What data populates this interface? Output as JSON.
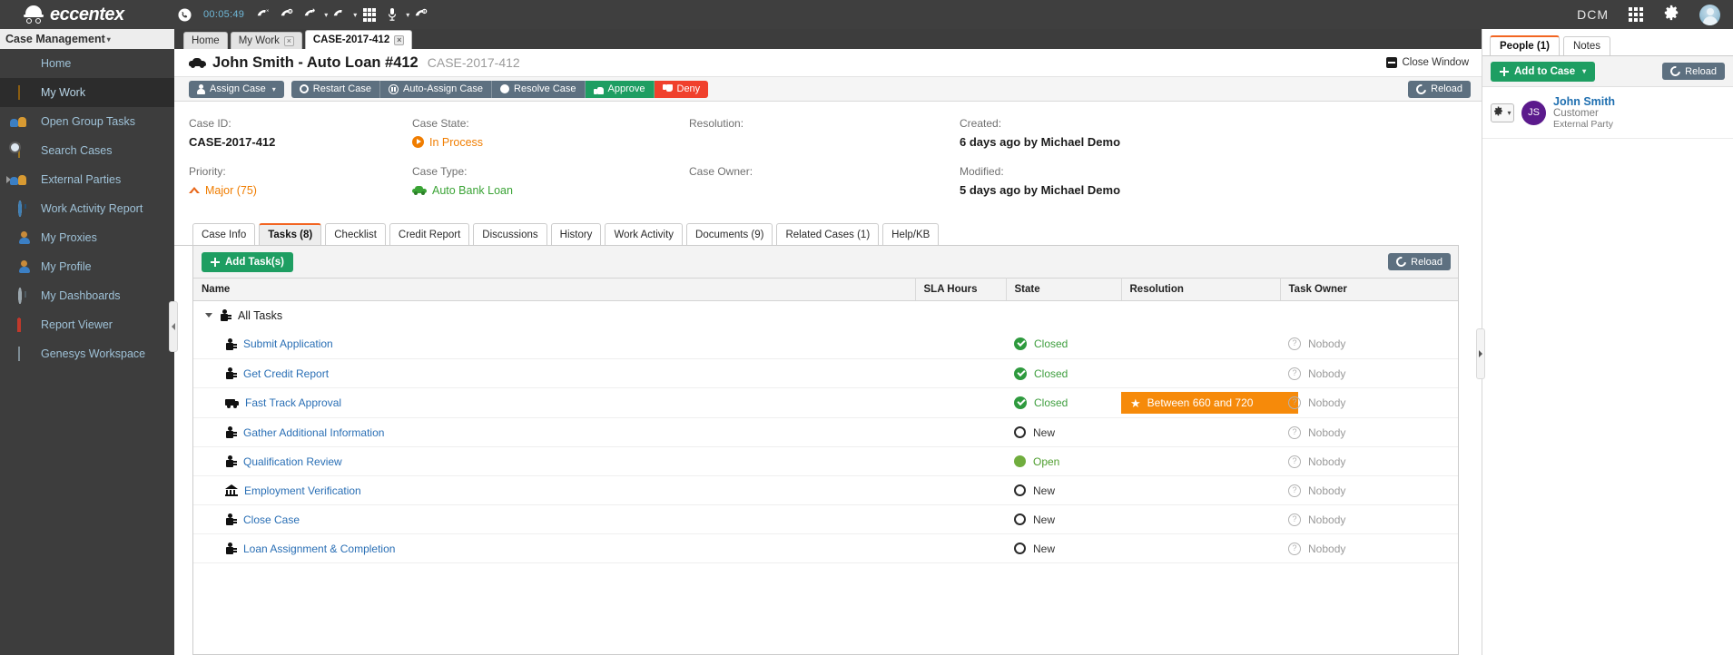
{
  "topbar": {
    "brand": "eccentex",
    "call_timer": "00:05:49",
    "phone_tools": [
      {
        "name": "call-active-icon",
        "glyph": "☎"
      },
      {
        "name": "call-reject-icon",
        "glyph": "☎"
      },
      {
        "name": "call-hold-icon",
        "glyph": "☎"
      },
      {
        "name": "call-transfer-icon",
        "glyph": "☎"
      },
      {
        "name": "call-consult-icon",
        "glyph": "☎"
      },
      {
        "name": "keypad-icon",
        "glyph": "keypad"
      },
      {
        "name": "microphone-icon",
        "glyph": "Ἲ4"
      },
      {
        "name": "call-pause-icon",
        "glyph": "☎"
      }
    ],
    "app_label": "DCM",
    "apps_icon": "grid-icon",
    "settings_icon": "gear-icon",
    "avatar_icon": "user-avatar-icon"
  },
  "sidebar": {
    "header": "Case Management",
    "items": [
      {
        "label": "Home",
        "icon": "pie-chart-icon",
        "active": false,
        "expandable": false
      },
      {
        "label": "My Work",
        "icon": "inbox-icon",
        "active": true,
        "expandable": false
      },
      {
        "label": "Open Group Tasks",
        "icon": "group-icon",
        "active": false,
        "expandable": false
      },
      {
        "label": "Search Cases",
        "icon": "folder-search-icon",
        "active": false,
        "expandable": false
      },
      {
        "label": "External Parties",
        "icon": "group-icon",
        "active": false,
        "expandable": true
      },
      {
        "label": "Work Activity Report",
        "icon": "clock-icon",
        "active": false,
        "expandable": false
      },
      {
        "label": "My Proxies",
        "icon": "person-icon",
        "active": false,
        "expandable": false
      },
      {
        "label": "My Profile",
        "icon": "person-icon",
        "active": false,
        "expandable": false
      },
      {
        "label": "My Dashboards",
        "icon": "dashboard-icon",
        "active": false,
        "expandable": false
      },
      {
        "label": "Report Viewer",
        "icon": "report-icon",
        "active": false,
        "expandable": false
      },
      {
        "label": "Genesys Workspace",
        "icon": "phone-device-icon",
        "active": false,
        "expandable": false
      }
    ]
  },
  "window_tabs": [
    {
      "label": "Home",
      "closable": false,
      "active": false
    },
    {
      "label": "My Work",
      "closable": true,
      "active": false
    },
    {
      "label": "CASE-2017-412",
      "closable": true,
      "active": true
    }
  ],
  "case_header": {
    "title": "John Smith - Auto Loan #412",
    "code": "CASE-2017-412",
    "close_window": "Close Window",
    "title_icon": "car-icon",
    "minimize_icon": "minimize-icon"
  },
  "action_bar": {
    "buttons": [
      {
        "label": "Assign Case",
        "style": "grey",
        "icon": "user-icon",
        "caret": true
      },
      {
        "label": "Restart Case",
        "style": "grey",
        "icon": "circle-outline-icon",
        "caret": false
      },
      {
        "label": "Auto-Assign Case",
        "style": "grey",
        "icon": "pause-circle-icon",
        "caret": false
      },
      {
        "label": "Resolve Case",
        "style": "grey",
        "icon": "circle-filled-icon",
        "caret": false
      },
      {
        "label": "Approve",
        "style": "green",
        "icon": "thumb-up-icon",
        "caret": false
      },
      {
        "label": "Deny",
        "style": "red",
        "icon": "thumb-down-icon",
        "caret": false
      }
    ],
    "reload_label": "Reload",
    "reload_icon": "refresh-icon"
  },
  "summary": {
    "case_id_label": "Case ID:",
    "case_id_value": "CASE-2017-412",
    "priority_label": "Priority:",
    "priority_value": "Major (75)",
    "case_state_label": "Case State:",
    "case_state_value": "In Process",
    "case_type_label": "Case Type:",
    "case_type_value": "Auto Bank Loan",
    "resolution_label": "Resolution:",
    "resolution_value": "",
    "case_owner_label": "Case Owner:",
    "case_owner_value": "",
    "created_label": "Created:",
    "created_value": "6 days ago by Michael Demo",
    "modified_label": "Modified:",
    "modified_value": "5 days ago by Michael Demo"
  },
  "content_tabs": [
    {
      "label": "Case Info",
      "active": false
    },
    {
      "label": "Tasks (8)",
      "active": true
    },
    {
      "label": "Checklist",
      "active": false
    },
    {
      "label": "Credit Report",
      "active": false
    },
    {
      "label": "Discussions",
      "active": false
    },
    {
      "label": "History",
      "active": false
    },
    {
      "label": "Work Activity",
      "active": false
    },
    {
      "label": "Documents (9)",
      "active": false
    },
    {
      "label": "Related Cases (1)",
      "active": false
    },
    {
      "label": "Help/KB",
      "active": false
    }
  ],
  "task_panel": {
    "add_task_label": "Add Task(s)",
    "reload_label": "Reload",
    "columns": [
      "Name",
      "SLA Hours",
      "State",
      "Resolution",
      "Task Owner"
    ],
    "root_row": {
      "name": "All Tasks",
      "icon": "task-icon"
    },
    "rows": [
      {
        "name": "Submit Application",
        "icon": "task-icon",
        "sla": "",
        "state": "Closed",
        "state_kind": "closed",
        "resolution": "",
        "owner": "Nobody"
      },
      {
        "name": "Get Credit Report",
        "icon": "task-icon",
        "sla": "",
        "state": "Closed",
        "state_kind": "closed",
        "resolution": "",
        "owner": "Nobody"
      },
      {
        "name": "Fast Track Approval",
        "icon": "truck-icon",
        "sla": "",
        "state": "Closed",
        "state_kind": "closed",
        "resolution": "Between 660 and 720",
        "owner": "Nobody"
      },
      {
        "name": "Gather Additional Information",
        "icon": "task-icon",
        "sla": "",
        "state": "New",
        "state_kind": "new",
        "resolution": "",
        "owner": "Nobody"
      },
      {
        "name": "Qualification Review",
        "icon": "task-icon",
        "sla": "",
        "state": "Open",
        "state_kind": "open",
        "resolution": "",
        "owner": "Nobody"
      },
      {
        "name": "Employment Verification",
        "icon": "bank-icon",
        "sla": "",
        "state": "New",
        "state_kind": "new",
        "resolution": "",
        "owner": "Nobody"
      },
      {
        "name": "Close Case",
        "icon": "task-icon",
        "sla": "",
        "state": "New",
        "state_kind": "new",
        "resolution": "",
        "owner": "Nobody"
      },
      {
        "name": "Loan Assignment & Completion",
        "icon": "task-icon",
        "sla": "",
        "state": "New",
        "state_kind": "new",
        "resolution": "",
        "owner": "Nobody"
      }
    ]
  },
  "right_panel": {
    "tabs": [
      {
        "label": "People (1)",
        "active": true
      },
      {
        "label": "Notes",
        "active": false
      }
    ],
    "add_to_case_label": "Add to Case",
    "reload_label": "Reload",
    "person": {
      "initials": "JS",
      "name": "John Smith",
      "role": "Customer",
      "type": "External Party",
      "gear_icon": "gear-icon"
    }
  },
  "colors": {
    "accent_orange": "#f26522",
    "green": "#1e9e62",
    "red": "#f0402c",
    "slate": "#5d7080",
    "badge_orange": "#f68a0a",
    "link_blue": "#2a6fb5"
  }
}
